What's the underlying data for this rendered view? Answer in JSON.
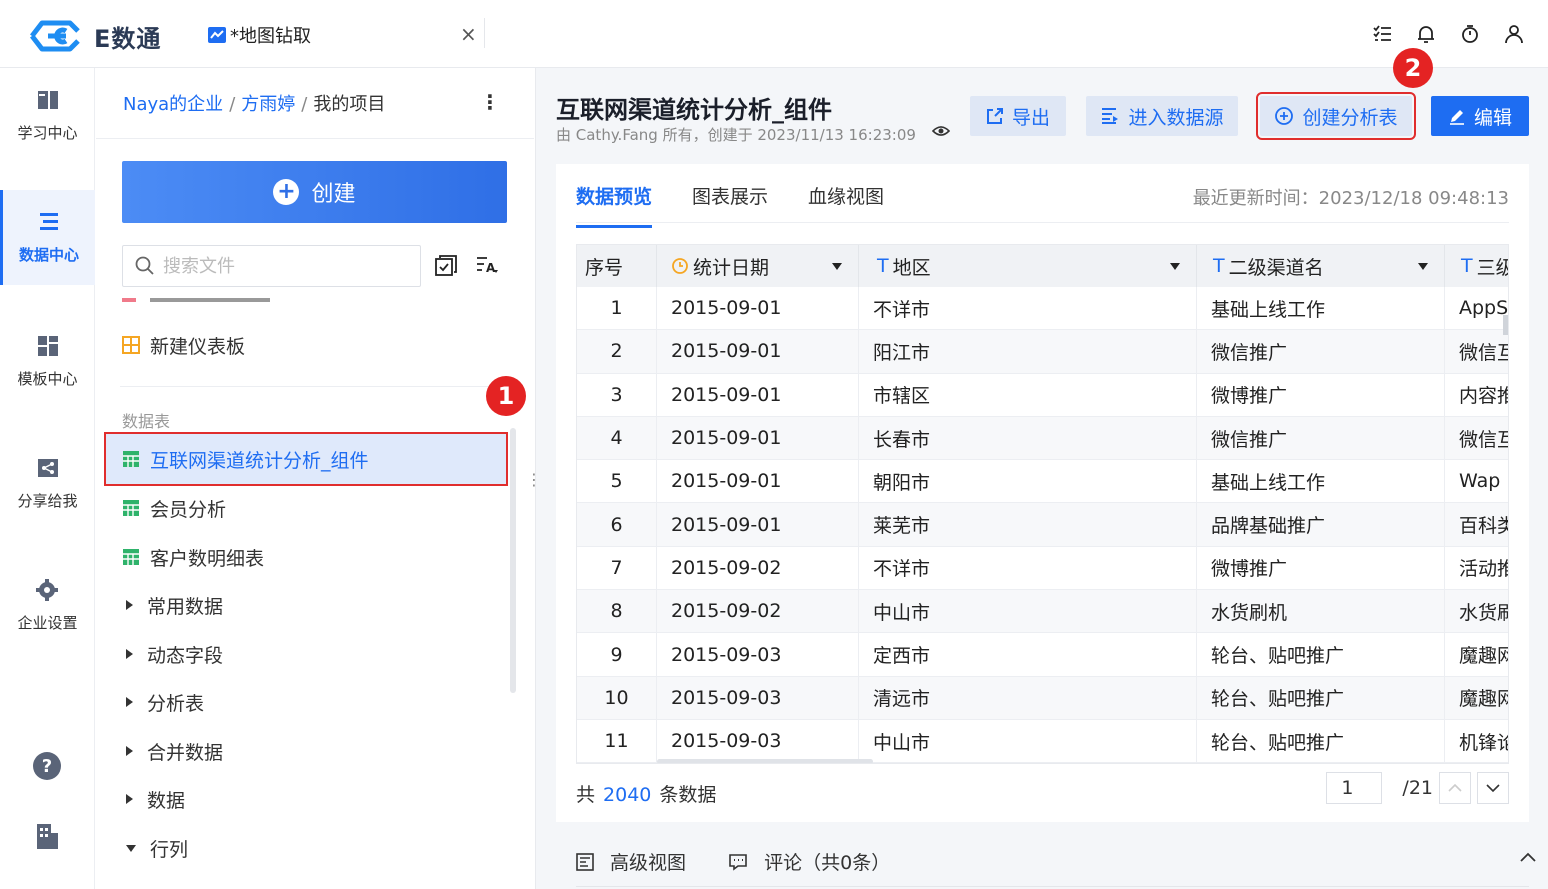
{
  "brand": {
    "name": "E数通"
  },
  "tab": {
    "title": "*地图钻取",
    "close": "×"
  },
  "top_icons": [
    "list-check-icon",
    "bell-icon",
    "stopwatch-icon",
    "user-icon"
  ],
  "rail": {
    "items": [
      {
        "label": "学习中心",
        "icon": "book-icon",
        "active": false
      },
      {
        "label": "数据中心",
        "icon": "data-list-icon",
        "active": true
      },
      {
        "label": "模板中心",
        "icon": "template-grid-icon",
        "active": false
      },
      {
        "label": "分享给我",
        "icon": "share-icon",
        "active": false
      },
      {
        "label": "企业设置",
        "icon": "gear-icon",
        "active": false
      }
    ]
  },
  "breadcrumb": {
    "org": "Naya的企业",
    "user": "方雨婷",
    "current": "我的项目",
    "sep": "/"
  },
  "create_button": {
    "label": "创建"
  },
  "search": {
    "placeholder": "搜索文件"
  },
  "files": {
    "dashboard": "新建仪表板",
    "section_label": "数据表",
    "tables": [
      "互联网渠道统计分析_组件",
      "会员分析",
      "客户数明细表"
    ],
    "folders": [
      "常用数据",
      "动态字段",
      "分析表",
      "合并数据",
      "数据",
      "行列"
    ]
  },
  "badges": {
    "one": "1",
    "two": "2"
  },
  "main": {
    "title": "互联网渠道统计分析_组件",
    "subtitle": "由 Cathy.Fang 所有，创建于 2023/11/13 16:23:09",
    "buttons": {
      "export": "导出",
      "datasource": "进入数据源",
      "create_analysis": "创建分析表",
      "edit": "编辑"
    },
    "tabs": [
      "数据预览",
      "图表展示",
      "血缘视图"
    ],
    "updated": "最近更新时间：2023/12/18 09:48:13"
  },
  "table": {
    "headers": [
      "序号",
      "统计日期",
      "地区",
      "二级渠道名",
      "三级"
    ],
    "rows": [
      [
        "1",
        "2015-09-01",
        "不详市",
        "基础上线工作",
        "AppSt"
      ],
      [
        "2",
        "2015-09-01",
        "阳江市",
        "微信推广",
        "微信互"
      ],
      [
        "3",
        "2015-09-01",
        "市辖区",
        "微博推广",
        "内容推"
      ],
      [
        "4",
        "2015-09-01",
        "长春市",
        "微信推广",
        "微信互"
      ],
      [
        "5",
        "2015-09-01",
        "朝阳市",
        "基础上线工作",
        "Wap"
      ],
      [
        "6",
        "2015-09-01",
        "莱芜市",
        "品牌基础推广",
        "百科类"
      ],
      [
        "7",
        "2015-09-02",
        "不详市",
        "微博推广",
        "活动推"
      ],
      [
        "8",
        "2015-09-02",
        "中山市",
        "水货刷机",
        "水货刷"
      ],
      [
        "9",
        "2015-09-03",
        "定西市",
        "轮台、贴吧推广",
        "魔趣网"
      ],
      [
        "10",
        "2015-09-03",
        "清远市",
        "轮台、贴吧推广",
        "魔趣网"
      ],
      [
        "11",
        "2015-09-03",
        "中山市",
        "轮台、贴吧推广",
        "机锋论"
      ]
    ]
  },
  "footer": {
    "prefix": "共",
    "count": "2040",
    "suffix": "条数据",
    "page": "1",
    "total_pages": "/21"
  },
  "bottom": {
    "advanced": "高级视图",
    "comments": "评论（共0条）"
  },
  "colors": {
    "accent": "#1e6df2",
    "highlight": "#e02d2d"
  }
}
